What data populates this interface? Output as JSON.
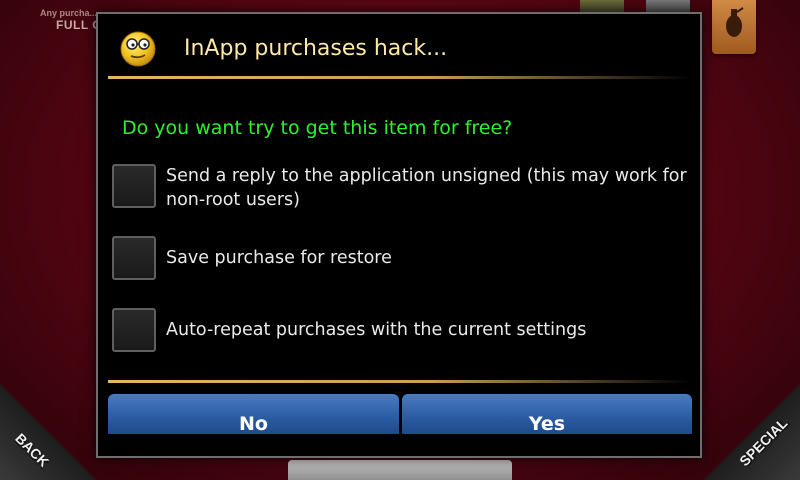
{
  "background": {
    "promo_small": "Any purcha...",
    "promo_big": "FULL C",
    "back_label": "BACK",
    "special_label": "SPECIAL"
  },
  "dialog": {
    "title": "InApp purchases hack...",
    "icon": "smiley-glasses-icon",
    "question": "Do you want try to get this item for free?",
    "options": [
      {
        "label": "Send a reply to the application unsigned (this may work for non-root users)",
        "checked": false
      },
      {
        "label": "Save purchase for restore",
        "checked": false
      },
      {
        "label": "Auto-repeat purchases with the current settings",
        "checked": false
      }
    ],
    "buttons": {
      "no": "No",
      "yes": "Yes"
    },
    "colors": {
      "title": "#ffe9a6",
      "question": "#2ef12e",
      "button": "#2a5ca3",
      "divider": "#e3b860"
    }
  }
}
